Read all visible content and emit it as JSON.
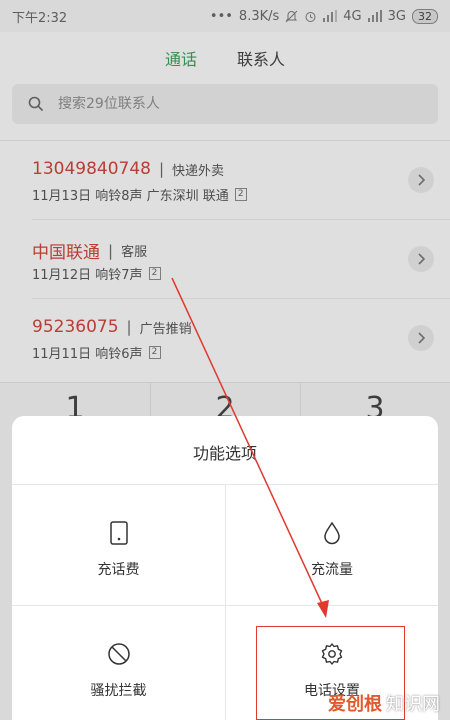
{
  "status_bar": {
    "time": "下午2:32",
    "dots": "•••",
    "speed": "8.3K/s",
    "network_4g": "4G",
    "network_3g": "3G",
    "battery": "32"
  },
  "tabs": [
    {
      "label": "通话",
      "active": true
    },
    {
      "label": "联系人",
      "active": false
    }
  ],
  "search": {
    "placeholder": "搜索29位联系人"
  },
  "calls": [
    {
      "number": "13049840748",
      "tag": "快递外卖",
      "detail": "11月13日  响铃8声  广东深圳 联通",
      "sim": "2"
    },
    {
      "number": "中国联通",
      "tag": "客服",
      "detail": "11月12日  响铃7声",
      "sim": "2"
    },
    {
      "number": "95236075",
      "tag": "广告推销",
      "detail": "11月11日  响铃6声",
      "sim": "2"
    }
  ],
  "dialpad": {
    "keys": [
      "1",
      "2",
      "3"
    ]
  },
  "sheet": {
    "title": "功能选项",
    "items": [
      {
        "label": "充话费",
        "icon": "phone-outline-icon"
      },
      {
        "label": "充流量",
        "icon": "droplet-icon"
      },
      {
        "label": "骚扰拦截",
        "icon": "block-icon"
      },
      {
        "label": "电话设置",
        "icon": "gear-icon"
      }
    ]
  },
  "watermark": {
    "logo": "爱创根",
    "text": "知识网"
  },
  "colors": {
    "accent_green": "#3c9b5a",
    "number_red": "#c9443a",
    "annotation_red": "#e03a2f"
  }
}
